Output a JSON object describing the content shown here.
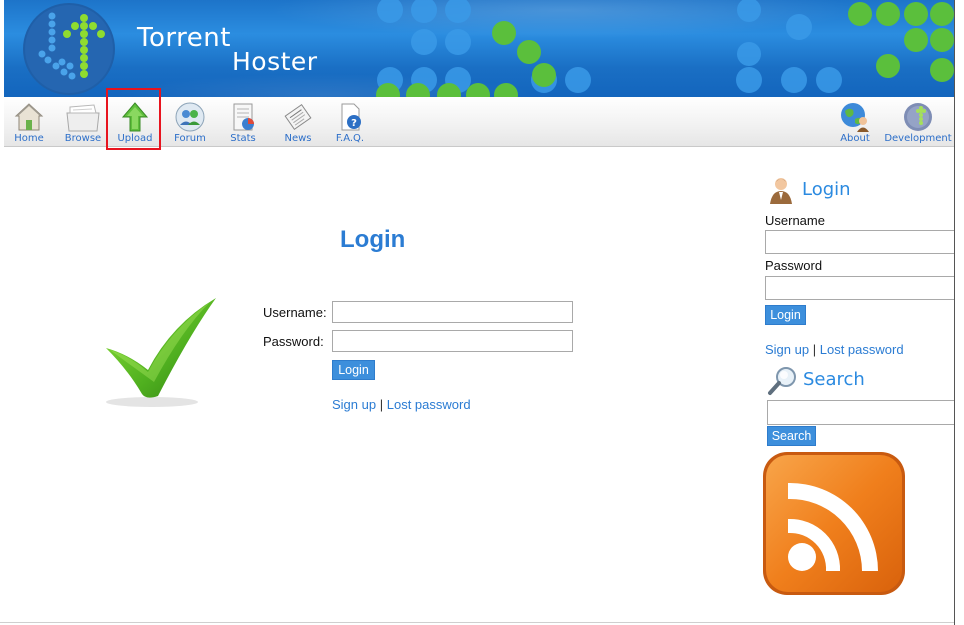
{
  "header": {
    "title_line1": "Torrent",
    "title_line2": "Hoster",
    "accent": "#1d74c9"
  },
  "toolbar": {
    "items": [
      {
        "label": "Home",
        "icon": "home-icon"
      },
      {
        "label": "Browse",
        "icon": "browse-icon"
      },
      {
        "label": "Upload",
        "icon": "upload-icon",
        "highlighted": true
      },
      {
        "label": "Forum",
        "icon": "forum-icon"
      },
      {
        "label": "Stats",
        "icon": "stats-icon"
      },
      {
        "label": "News",
        "icon": "news-icon"
      },
      {
        "label": "F.A.Q.",
        "icon": "faq-icon"
      }
    ],
    "right_items": [
      {
        "label": "About",
        "icon": "about-icon"
      },
      {
        "label": "Development",
        "icon": "development-icon"
      }
    ],
    "highlight_color": "#e8141e"
  },
  "main": {
    "title": "Login",
    "username_label": "Username:",
    "password_label": "Password:",
    "username_value": "",
    "password_value": "",
    "login_button": "Login",
    "signup_link": "Sign up",
    "separator": "|",
    "lost_password_link": "Lost password",
    "icon": "checkmark-icon"
  },
  "sidebar": {
    "login": {
      "heading": "Login",
      "icon": "user-icon",
      "username_label": "Username",
      "password_label": "Password",
      "username_value": "",
      "password_value": "",
      "login_button": "Login",
      "signup_link": "Sign up",
      "separator": "|",
      "lost_password_link": "Lost password"
    },
    "search": {
      "heading": "Search",
      "icon": "magnifier-icon",
      "value": "",
      "button": "Search"
    },
    "rss": {
      "icon": "rss-icon",
      "color": "#f07f1c"
    }
  }
}
